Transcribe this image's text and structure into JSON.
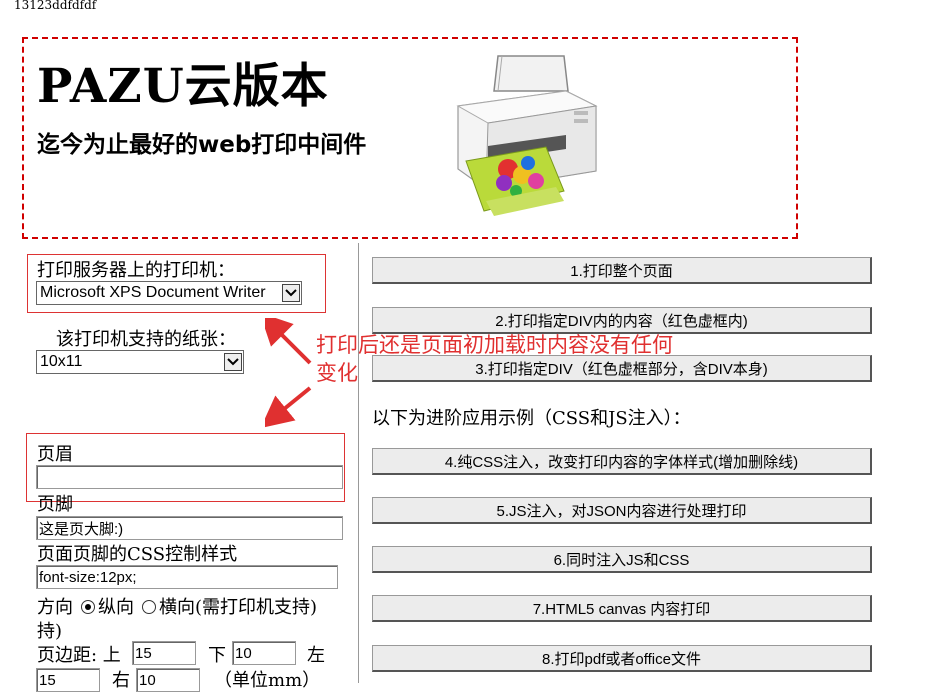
{
  "top_text": "13123ddfdfdf",
  "hero": {
    "title": "PAZU云版本",
    "subtitle": "迄今为止最好的web打印中间件"
  },
  "left": {
    "printer_label": "打印服务器上的打印机：",
    "printer_selected": "Microsoft XPS Document Writer",
    "paper_label": "该打印机支持的纸张：",
    "paper_selected": "10x11",
    "header_label": "页眉",
    "header_value": "",
    "footer_label": "页脚",
    "footer_value": "这是页大脚:)",
    "css_label": "页面页脚的CSS控制样式",
    "css_value": "font-size:12px;",
    "orientation_label": "方向",
    "portrait_label": "纵向",
    "landscape_label": "横向(需打印机支持)",
    "orientation_wrap": "持)",
    "margin_label": "页边距: 上",
    "margin_top": "15",
    "margin_bottom_label": "下",
    "margin_bottom": "10",
    "margin_left_label": "左",
    "margin_left": "15",
    "margin_right_label": "右",
    "margin_right": "10",
    "unit_label": "（单位mm）"
  },
  "annotation": {
    "line1": "打印后还是页面初加载时内容没有任何",
    "line2": "变化",
    "color": "#e03030"
  },
  "buttons": [
    "1.打印整个页面",
    "2.打印指定DIV内的内容（红色虚框内)",
    "3.打印指定DIV（红色虚框部分，含DIV本身)",
    "4.纯CSS注入，改变打印内容的字体样式(增加删除线)",
    "5.JS注入，对JSON内容进行处理打印",
    "6.同时注入JS和CSS",
    "7.HTML5 canvas 内容打印",
    "8.打印pdf或者office文件"
  ],
  "advanced_label": "以下为进阶应用示例（CSS和JS注入）："
}
